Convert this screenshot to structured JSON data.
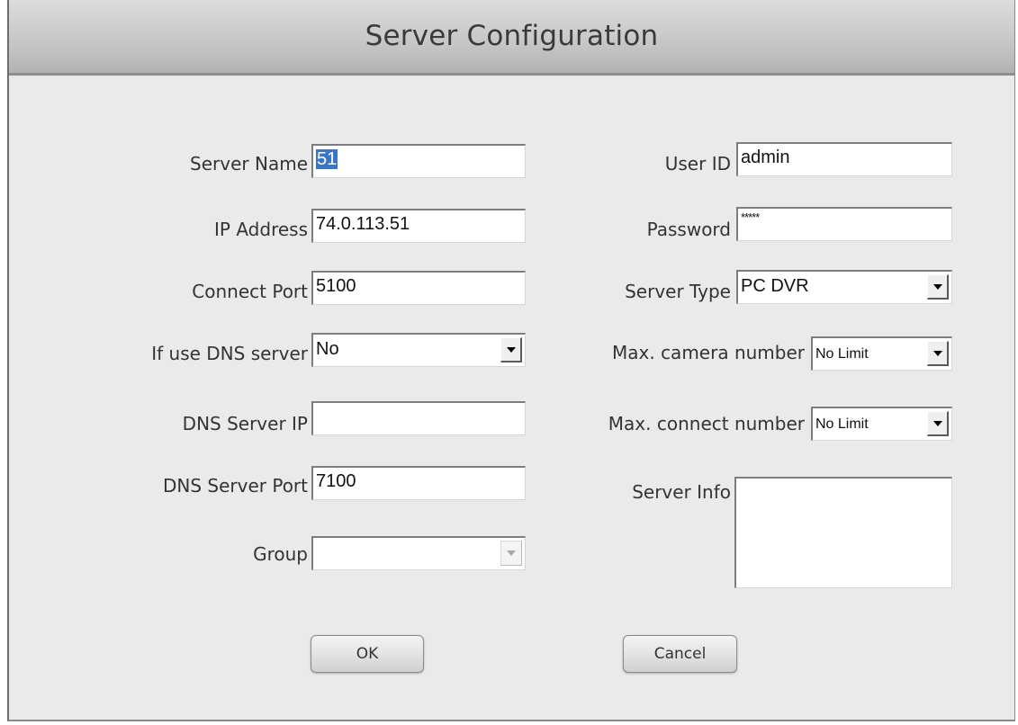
{
  "dialog": {
    "title": "Server Configuration"
  },
  "left": {
    "server_name": {
      "label": "Server Name",
      "value": "51"
    },
    "ip_address": {
      "label": "IP Address",
      "value": "74.0.113.51"
    },
    "connect_port": {
      "label": "Connect Port",
      "value": "5100"
    },
    "use_dns": {
      "label": "If use DNS server",
      "value": "No"
    },
    "dns_ip": {
      "label": "DNS Server IP",
      "value": ""
    },
    "dns_port": {
      "label": "DNS Server Port",
      "value": "7100"
    },
    "group": {
      "label": "Group",
      "value": ""
    }
  },
  "right": {
    "user_id": {
      "label": "User ID",
      "value": "admin"
    },
    "password": {
      "label": "Password",
      "value": "*****"
    },
    "server_type": {
      "label": "Server Type",
      "value": "PC DVR"
    },
    "max_camera": {
      "label": "Max. camera number",
      "value": "No Limit"
    },
    "max_connect": {
      "label": "Max. connect number",
      "value": "No Limit"
    },
    "server_info": {
      "label": "Server Info",
      "value": ""
    }
  },
  "buttons": {
    "ok": "OK",
    "cancel": "Cancel"
  },
  "icons": {
    "dropdown": "chevron-down-icon"
  },
  "colors": {
    "selection": "#3a76c4",
    "titlebar": "#c6c6c6",
    "background": "#eaeaea"
  }
}
